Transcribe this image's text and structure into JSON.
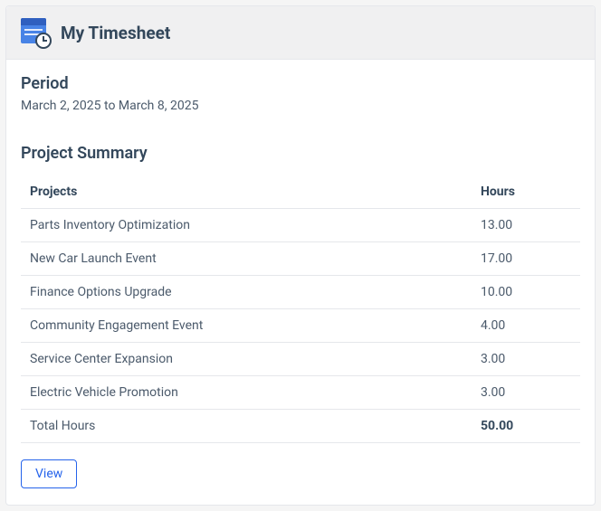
{
  "header": {
    "title": "My Timesheet"
  },
  "period": {
    "label": "Period",
    "text": "March 2, 2025 to March 8, 2025"
  },
  "summary": {
    "title": "Project Summary",
    "columns": {
      "projects": "Projects",
      "hours": "Hours"
    },
    "rows": [
      {
        "project": "Parts Inventory Optimization",
        "hours": "13.00"
      },
      {
        "project": "New Car Launch Event",
        "hours": "17.00"
      },
      {
        "project": "Finance Options Upgrade",
        "hours": "10.00"
      },
      {
        "project": "Community Engagement Event",
        "hours": "4.00"
      },
      {
        "project": "Service Center Expansion",
        "hours": "3.00"
      },
      {
        "project": "Electric Vehicle Promotion",
        "hours": "3.00"
      }
    ],
    "total": {
      "label": "Total Hours",
      "hours": "50.00"
    }
  },
  "actions": {
    "view": "View"
  }
}
